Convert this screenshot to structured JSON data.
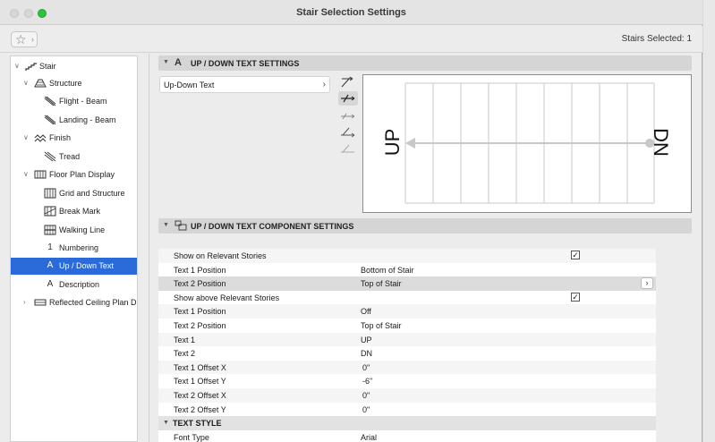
{
  "window": {
    "title": "Stair Selection Settings"
  },
  "toolbar": {
    "stairs_selected": "Stairs Selected: 1"
  },
  "sidebar": {
    "items": [
      {
        "label": "Stair",
        "icon": "stair-icon",
        "level": 0,
        "expanded": true
      },
      {
        "label": "Structure",
        "icon": "structure-icon",
        "level": 1,
        "expanded": true
      },
      {
        "label": "Flight - Beam",
        "icon": "flight-beam-icon",
        "level": 2
      },
      {
        "label": "Landing - Beam",
        "icon": "landing-beam-icon",
        "level": 2
      },
      {
        "label": "Finish",
        "icon": "finish-icon",
        "level": 1,
        "expanded": true
      },
      {
        "label": "Tread",
        "icon": "tread-icon",
        "level": 2
      },
      {
        "label": "Floor Plan Display",
        "icon": "floor-plan-icon",
        "level": 1,
        "expanded": true
      },
      {
        "label": "Grid and Structure",
        "icon": "grid-icon",
        "level": 2
      },
      {
        "label": "Break Mark",
        "icon": "break-mark-icon",
        "level": 2
      },
      {
        "label": "Walking Line",
        "icon": "walking-line-icon",
        "level": 2
      },
      {
        "label": "Numbering",
        "icon": "numbering-icon",
        "level": 2
      },
      {
        "label": "Up / Down Text",
        "icon": "text-a-icon",
        "level": 2,
        "selected": true
      },
      {
        "label": "Description",
        "icon": "text-a-icon",
        "level": 2
      },
      {
        "label": "Reflected Ceiling Plan D",
        "icon": "ceiling-plan-icon",
        "level": 1,
        "expanded": false
      }
    ]
  },
  "section1": {
    "title": "UP / DOWN TEXT SETTINGS",
    "dropdown_value": "Up-Down Text",
    "preview": {
      "up_text": "UP",
      "dn_text": "DN"
    }
  },
  "section2": {
    "title": "UP / DOWN TEXT COMPONENT SETTINGS"
  },
  "rows": [
    {
      "name": "Show on Relevant Stories",
      "checkbox": true
    },
    {
      "name": "Text 1 Position",
      "value": "Bottom of Stair"
    },
    {
      "name": "Text 2 Position",
      "value": "Top of Stair",
      "highlighted": true
    },
    {
      "name": "Show above Relevant Stories",
      "checkbox": true
    },
    {
      "name": "Text 1 Position",
      "value": "Off"
    },
    {
      "name": "Text 2 Position",
      "value": "Top of Stair"
    },
    {
      "name": "Text 1",
      "value": "UP"
    },
    {
      "name": "Text 2",
      "value": "DN"
    },
    {
      "name": "Text 1 Offset X",
      "value": "0\""
    },
    {
      "name": "Text 1 Offset Y",
      "value": "-6\""
    },
    {
      "name": "Text 2 Offset X",
      "value": "0\""
    },
    {
      "name": "Text 2 Offset Y",
      "value": "0\""
    },
    {
      "name": "TEXT STYLE",
      "section": true
    },
    {
      "name": "Font Type",
      "value": "Arial"
    }
  ],
  "colors": {
    "selection": "#2a6bd9",
    "maximize": "#2fc23f"
  }
}
